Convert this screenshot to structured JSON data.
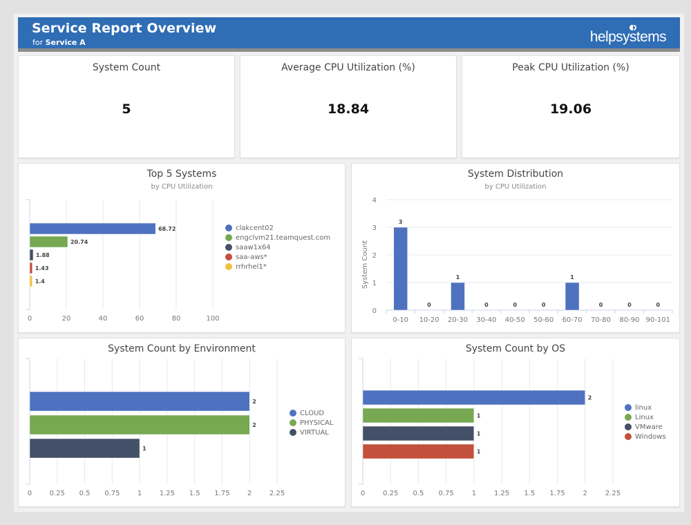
{
  "header": {
    "title": "Service Report Overview",
    "subtitle_prefix": "for",
    "subtitle_service": "Service A",
    "logo_text": "helpsystems"
  },
  "kpis": [
    {
      "label": "System Count",
      "value": "5"
    },
    {
      "label": "Average CPU Utilization (%)",
      "value": "18.84"
    },
    {
      "label": "Peak CPU Utilization (%)",
      "value": "19.06"
    }
  ],
  "colors": {
    "header_bg": "#2f6db5",
    "blue": "#4e72bf",
    "green": "#77a852",
    "navy": "#445068",
    "red": "#c2503a",
    "yellow": "#f2c03e"
  },
  "chart_data": [
    {
      "id": "top5",
      "type": "bar",
      "orientation": "horizontal",
      "title": "Top 5 Systems",
      "subtitle": "by CPU Utilization",
      "categories": [
        "clakcent02",
        "engclvm21.teamquest.com",
        "saaw1x64",
        "saa-aws*",
        "rrhrhel1*"
      ],
      "values": [
        68.72,
        20.74,
        1.88,
        1.43,
        1.4
      ],
      "value_labels": [
        "68.72",
        "20.74",
        "1.88",
        "1.43",
        "1.4"
      ],
      "colors": [
        "#4e72bf",
        "#77a852",
        "#445068",
        "#c2503a",
        "#f2c03e"
      ],
      "xlim": [
        0,
        100
      ],
      "xticks": [
        0,
        20,
        40,
        60,
        80,
        100
      ],
      "xlabel": "",
      "ylabel": "",
      "grid": true,
      "legend": "right"
    },
    {
      "id": "dist",
      "type": "bar",
      "orientation": "vertical",
      "title": "System Distribution",
      "subtitle": "by CPU Utilization",
      "categories": [
        "0-10",
        "10-20",
        "20-30",
        "30-40",
        "40-50",
        "50-60",
        "60-70",
        "70-80",
        "80-90",
        "90-101"
      ],
      "values": [
        3,
        0,
        1,
        0,
        0,
        0,
        1,
        0,
        0,
        0
      ],
      "color": "#4e72bf",
      "ylim": [
        0,
        4
      ],
      "yticks": [
        0,
        1,
        2,
        3,
        4
      ],
      "xlabel": "",
      "ylabel": "System Count",
      "grid": true,
      "legend": "none"
    },
    {
      "id": "env",
      "type": "bar",
      "orientation": "horizontal",
      "title": "System Count by Environment",
      "subtitle": "",
      "categories": [
        "CLOUD",
        "PHYSICAL",
        "VIRTUAL"
      ],
      "values": [
        2,
        2,
        1
      ],
      "value_labels": [
        "2",
        "2",
        "1"
      ],
      "colors": [
        "#4e72bf",
        "#77a852",
        "#445068"
      ],
      "xlim": [
        0,
        2.25
      ],
      "xticks": [
        "0",
        "0.25",
        "0.5",
        "0.75",
        "1",
        "1.25",
        "1.5",
        "1.75",
        "2",
        "2.25"
      ],
      "xlabel": "",
      "ylabel": "",
      "grid": true,
      "legend": "right"
    },
    {
      "id": "os",
      "type": "bar",
      "orientation": "horizontal",
      "title": "System Count by OS",
      "subtitle": "",
      "categories": [
        "linux",
        "Linux",
        "VMware",
        "Windows"
      ],
      "values": [
        2,
        1,
        1,
        1
      ],
      "value_labels": [
        "2",
        "1",
        "1",
        "1"
      ],
      "colors": [
        "#4e72bf",
        "#77a852",
        "#445068",
        "#c2503a"
      ],
      "xlim": [
        0,
        2.25
      ],
      "xticks": [
        "0",
        "0.25",
        "0.5",
        "0.75",
        "1",
        "1.25",
        "1.5",
        "1.75",
        "2",
        "2.25"
      ],
      "xlabel": "",
      "ylabel": "",
      "grid": true,
      "legend": "right"
    }
  ]
}
